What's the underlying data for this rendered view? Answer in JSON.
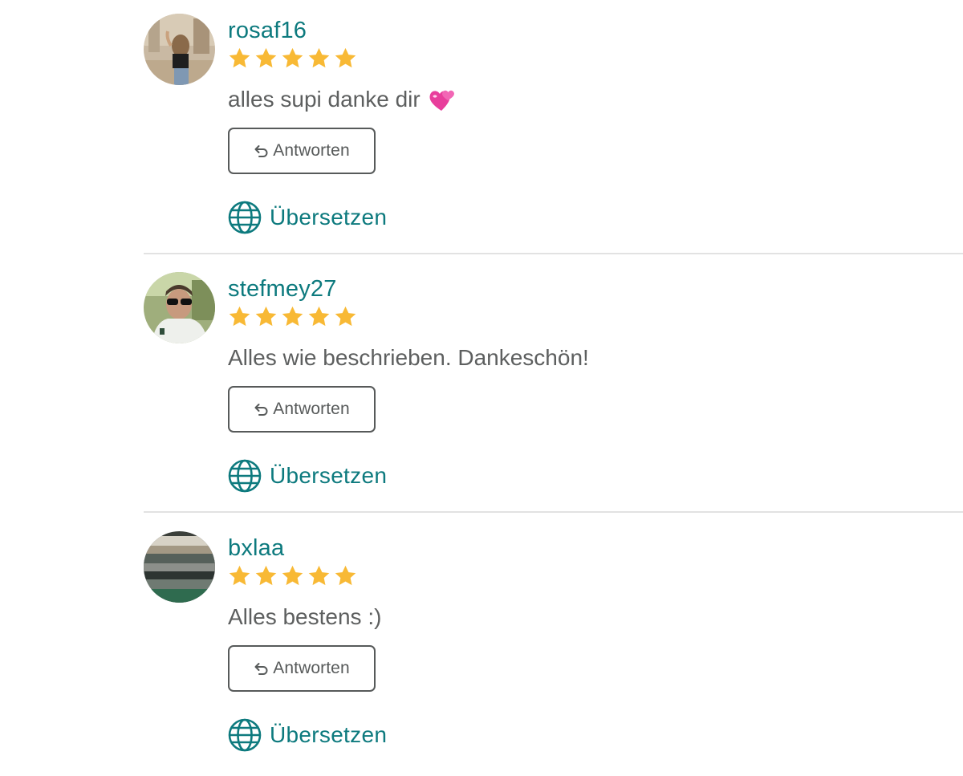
{
  "colors": {
    "accent": "#0d7a7e",
    "star": "#f8b935",
    "text": "#5d5f5f",
    "button_border": "#575a5a",
    "divider": "#e2e2e2"
  },
  "reviews": [
    {
      "username": "rosaf16",
      "rating": 5,
      "comment": "alles supi danke dir",
      "comment_emoji": "revolving-hearts-emoji",
      "reply_label": "Antworten",
      "translate_label": "Übersetzen",
      "avatar": "user-photo-rosaf16"
    },
    {
      "username": "stefmey27",
      "rating": 5,
      "comment": "Alles wie beschrieben. Dankeschön!",
      "comment_emoji": "",
      "reply_label": "Antworten",
      "translate_label": "Übersetzen",
      "avatar": "user-photo-stefmey27"
    },
    {
      "username": "bxlaa",
      "rating": 5,
      "comment": "Alles bestens :)",
      "comment_emoji": "",
      "reply_label": "Antworten",
      "translate_label": "Übersetzen",
      "avatar": "user-photo-bxlaa"
    }
  ],
  "icons": {
    "star": "star-icon",
    "reply": "reply-arrow-icon",
    "translate": "globe-icon"
  }
}
